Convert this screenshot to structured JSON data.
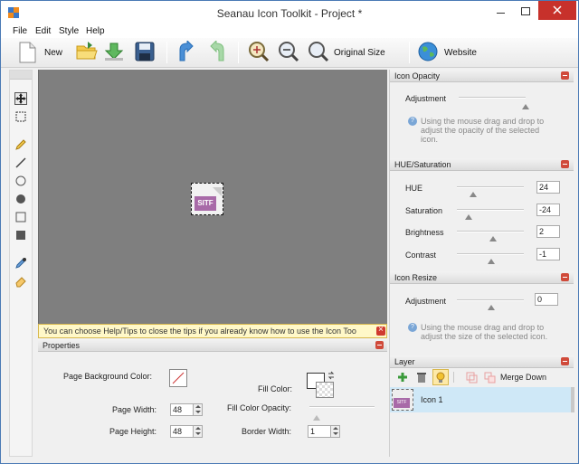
{
  "window": {
    "title": "Seanau Icon Toolkit - Project *"
  },
  "menu": {
    "items": [
      "File",
      "Edit",
      "Style",
      "Help"
    ]
  },
  "toolbar": {
    "new_label": "New",
    "original_size_label": "Original Size",
    "website_label": "Website",
    "icons": [
      "new-document-icon",
      "open-folder-icon",
      "import-icon",
      "save-icon",
      "undo-icon",
      "redo-icon",
      "zoom-in-icon",
      "zoom-out-icon",
      "original-size-icon",
      "globe-icon"
    ]
  },
  "canvas": {
    "icon_text": "SITF"
  },
  "tip": {
    "text": "You can choose Help/Tips to close the tips if you already know how to use the Icon Too"
  },
  "properties": {
    "header": "Properties",
    "page_background_color_label": "Page Background Color:",
    "page_width_label": "Page Width:",
    "page_width_value": "48",
    "page_height_label": "Page Height:",
    "page_height_value": "48",
    "fill_color_label": "Fill Color:",
    "fill_color_opacity_label": "Fill Color Opacity:",
    "border_width_label": "Border Width:",
    "border_width_value": "1"
  },
  "icon_opacity": {
    "header": "Icon Opacity",
    "adjustment_label": "Adjustment",
    "hint": "Using the mouse drag and drop to adjust the opacity of the selected icon.",
    "hint_lines": [
      "Using the mouse drag and drop to",
      "adjust the opacity of the selected",
      "icon."
    ]
  },
  "hue_saturation": {
    "header": "HUE/Saturation",
    "hue_label": "HUE",
    "hue_value": "24",
    "saturation_label": "Saturation",
    "saturation_value": "-24",
    "brightness_label": "Brightness",
    "brightness_value": "2",
    "contrast_label": "Contrast",
    "contrast_value": "-1"
  },
  "icon_resize": {
    "header": "Icon Resize",
    "adjustment_label": "Adjustment",
    "adjustment_value": "0",
    "hint": "Using the mouse drag and drop to adjust the size of the selected icon.",
    "hint_lines": [
      "Using the mouse drag and drop to",
      "adjust the size of the selected icon."
    ]
  },
  "layer": {
    "header": "Layer",
    "merge_down_label": "Merge Down",
    "items": [
      {
        "name": "Icon 1",
        "thumb_text": "SITF"
      }
    ]
  },
  "colors": {
    "accent_close": "#c7312b",
    "canvas_bg": "#7f7f7f",
    "tip_bg": "#fff8c8",
    "layer_selected": "#cfe8f7",
    "icon_badge": "#a86aa8"
  }
}
